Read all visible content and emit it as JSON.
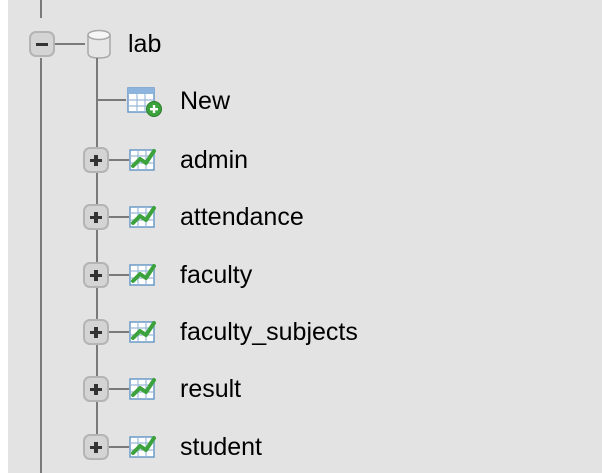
{
  "tree": {
    "database": {
      "label": "lab",
      "expanded": true,
      "icon": "database-icon"
    },
    "new_item": {
      "label": "New",
      "icon": "new-table-icon"
    },
    "tables": [
      {
        "label": "admin",
        "icon": "table-icon"
      },
      {
        "label": "attendance",
        "icon": "table-icon"
      },
      {
        "label": "faculty",
        "icon": "table-icon"
      },
      {
        "label": "faculty_subjects",
        "icon": "table-icon"
      },
      {
        "label": "result",
        "icon": "table-icon"
      },
      {
        "label": "student",
        "icon": "table-icon"
      }
    ]
  },
  "colors": {
    "panel_background": "#e3e3e3",
    "tree_line": "#7a7a7a",
    "expander_fill": "#d4d4d4",
    "table_icon_green": "#3ca33c",
    "table_icon_blue": "#6aa3d8"
  }
}
